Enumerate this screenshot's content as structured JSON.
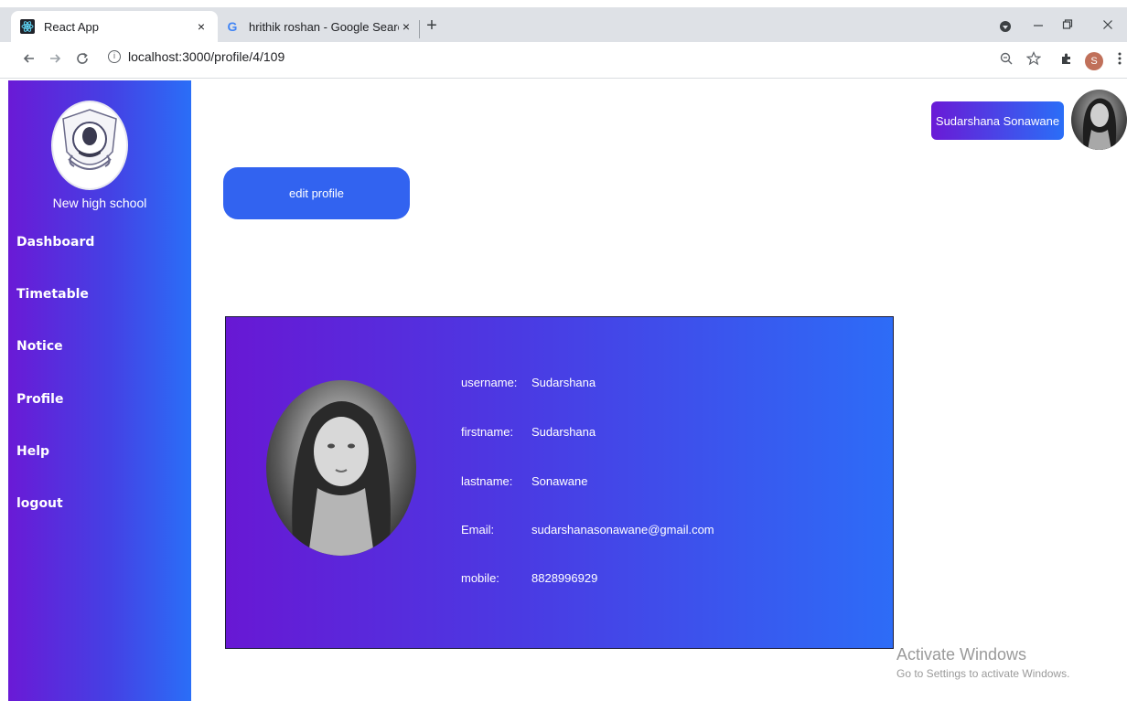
{
  "browser": {
    "tabs": [
      {
        "title": "React App",
        "active": true
      },
      {
        "title": "hrithik roshan - Google Search",
        "active": false
      }
    ],
    "tab_close": "×",
    "new_tab": "+",
    "url": "localhost:3000/profile/4/109",
    "profile_initial": "S"
  },
  "sidebar": {
    "school_name": "New high school",
    "items": [
      {
        "label": "Dashboard"
      },
      {
        "label": "Timetable"
      },
      {
        "label": "Notice"
      },
      {
        "label": "Profile"
      },
      {
        "label": "Help"
      },
      {
        "label": "logout"
      }
    ]
  },
  "header": {
    "user_name": "Sudarshana Sonawane"
  },
  "main": {
    "edit_label": "edit profile"
  },
  "profile": {
    "fields": [
      {
        "label": "username:",
        "value": "Sudarshana"
      },
      {
        "label": "firstname:",
        "value": "Sudarshana"
      },
      {
        "label": "lastname:",
        "value": "Sonawane"
      },
      {
        "label": "Email:",
        "value": "sudarshanasonawane@gmail.com"
      },
      {
        "label": "mobile:",
        "value": "8828996929"
      }
    ]
  },
  "watermark": {
    "line1": "Activate Windows",
    "line2": "Go to Settings to activate Windows."
  },
  "colors": {
    "gradient_start": "#6a1ad6",
    "gradient_end": "#2a6ef7",
    "button": "#3263f0"
  }
}
